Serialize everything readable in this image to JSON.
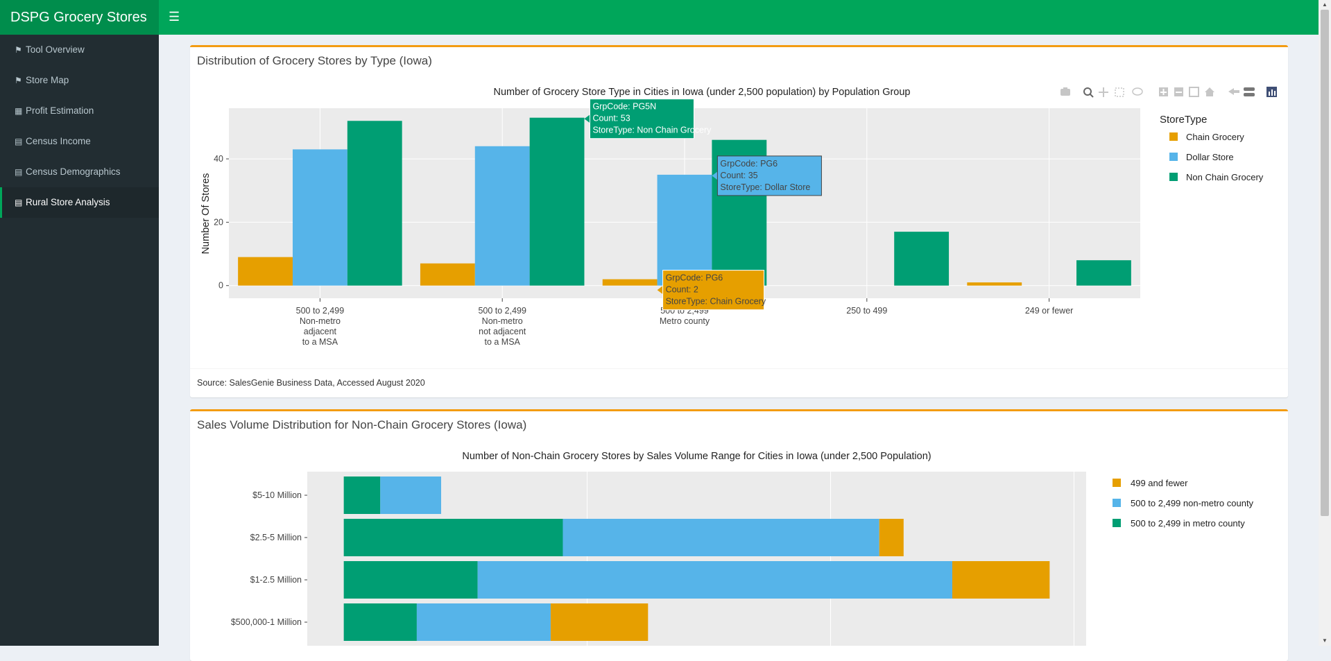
{
  "app": {
    "title": "DSPG Grocery Stores"
  },
  "sidebar": {
    "items": [
      {
        "label": "Tool Overview",
        "icon": "map-marked-icon"
      },
      {
        "label": "Store Map",
        "icon": "map-marked-icon"
      },
      {
        "label": "Profit Estimation",
        "icon": "calculator-icon"
      },
      {
        "label": "Census Income",
        "icon": "area-chart-icon"
      },
      {
        "label": "Census Demographics",
        "icon": "area-chart-icon"
      },
      {
        "label": "Rural Store Analysis",
        "icon": "area-chart-icon"
      }
    ],
    "active_index": 5
  },
  "box1": {
    "title": "Distribution of Grocery Stores by Type (Iowa)",
    "footer": "Source: SalesGenie Business Data, Accessed August 2020"
  },
  "box2": {
    "title": "Sales Volume Distribution for Non-Chain Grocery Stores (Iowa)"
  },
  "colors": {
    "orange": "#e69f00",
    "blue": "#56b4e9",
    "green": "#009e73",
    "plot_bg": "#ebebeb"
  },
  "chart_data": [
    {
      "type": "bar",
      "title": "Number of Grocery Store Type in Cities in Iowa (under 2,500 population) by Population Group",
      "ylabel": "Number Of Stores",
      "xlabel": "",
      "legend_title": "StoreType",
      "legend_position": "right",
      "ylim": [
        -4,
        56
      ],
      "yticks": [
        0,
        20,
        40
      ],
      "categories": [
        [
          "500 to 2,499",
          "Non-metro",
          "adjacent",
          "to a MSA"
        ],
        [
          "500 to 2,499",
          "Non-metro",
          "not adjacent",
          "to a MSA"
        ],
        [
          "500 to 2,499",
          "Metro county"
        ],
        [
          "250 to 499"
        ],
        [
          "249 or fewer"
        ]
      ],
      "series": [
        {
          "name": "Chain Grocery",
          "color": "#e69f00",
          "values": [
            9,
            7,
            2,
            0,
            1
          ]
        },
        {
          "name": "Dollar Store",
          "color": "#56b4e9",
          "values": [
            43,
            44,
            35,
            0,
            0
          ]
        },
        {
          "name": "Non Chain Grocery",
          "color": "#009e73",
          "values": [
            52,
            53,
            46,
            17,
            8
          ]
        }
      ],
      "tooltips": [
        {
          "lines": [
            "GrpCode: PG5N",
            "Count: 53",
            "StoreType: Non Chain Grocery"
          ],
          "color": "#009e73",
          "cat": 1,
          "series": 2
        },
        {
          "lines": [
            "GrpCode: PG6",
            "Count: 35",
            "StoreType: Dollar Store"
          ],
          "color": "#56b4e9",
          "cat": 2,
          "series": 1
        },
        {
          "lines": [
            "GrpCode: PG6",
            "Count:  2",
            "StoreType: Chain Grocery"
          ],
          "color": "#e69f00",
          "cat": 2,
          "series": 0
        }
      ]
    },
    {
      "type": "bar",
      "orientation": "horizontal",
      "stacked": true,
      "title": "Number of Non-Chain Grocery Stores by Sales Volume Range for Cities in Iowa (under 2,500 Population)",
      "legend_position": "right",
      "categories": [
        "$5-10 Million",
        "$2.5-5 Million",
        "$1-2.5 Million",
        "$500,000-1 Million"
      ],
      "series": [
        {
          "name": "500 to 2,499 in metro county",
          "color": "#009e73",
          "values": [
            3,
            18,
            11,
            6
          ]
        },
        {
          "name": "500 to 2,499 non-metro county",
          "color": "#56b4e9",
          "values": [
            5,
            26,
            39,
            11
          ]
        },
        {
          "name": "499 and fewer",
          "color": "#e69f00",
          "values": [
            0,
            2,
            8,
            8
          ]
        }
      ],
      "legend_order": [
        "499 and fewer",
        "500 to 2,499 non-metro county",
        "500 to 2,499 in metro county"
      ],
      "xlim": [
        -3,
        61
      ]
    }
  ]
}
